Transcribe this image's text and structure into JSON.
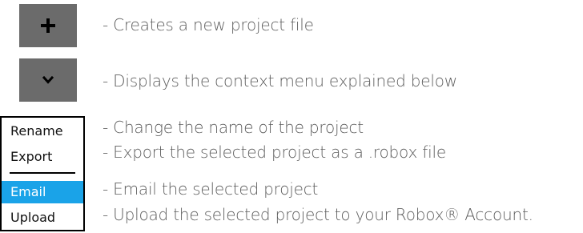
{
  "buttons": {
    "new_project_icon": "plus-icon",
    "context_menu_icon": "chevron-down-icon",
    "color": "#6b6b6b"
  },
  "descriptions": {
    "new_project": "- Creates  a new project file",
    "context_menu": "- Displays the context menu explained below",
    "rename": "- Change the name of the project",
    "export": "- Export the selected project as a .robox file",
    "email": "- Email the selected project",
    "upload": "- Upload the selected project to your Robox® Account."
  },
  "context_menu": {
    "items": [
      {
        "label": "Rename"
      },
      {
        "label": "Export"
      },
      {
        "label": "Email",
        "selected": true
      },
      {
        "label": "Upload"
      }
    ],
    "selected_color": "#1aa3e8"
  }
}
